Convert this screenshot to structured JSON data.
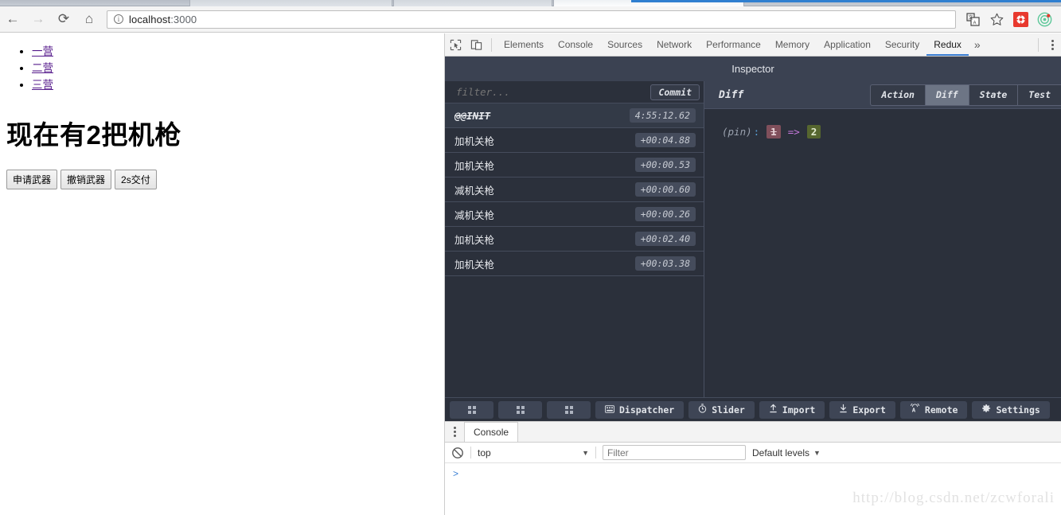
{
  "browser": {
    "back_icon": "back-arrow-icon",
    "forward_icon": "forward-arrow-icon",
    "reload_icon": "reload-icon",
    "home_icon": "home-icon",
    "info_glyph": "i",
    "url_host": "localhost",
    "url_port": ":3000",
    "url_full": "localhost:3000",
    "translate_icon": "translate-icon",
    "bookmark_icon": "star-icon",
    "extension_red_icon": "extension-icon",
    "extension_green_icon": "react-devtools-icon",
    "tab_accent": "#2f7fd0"
  },
  "page": {
    "links": [
      {
        "label": "一营"
      },
      {
        "label": "二营"
      },
      {
        "label": "三营"
      }
    ],
    "heading": "现在有2把机枪",
    "buttons": [
      {
        "label": "申请武器"
      },
      {
        "label": "撤销武器"
      },
      {
        "label": "2s交付"
      }
    ],
    "link_color": "#551a8b"
  },
  "devtools": {
    "inspect_element_icon": "inspect-element-icon",
    "device_toolbar_icon": "device-toolbar-icon",
    "tabs": [
      {
        "label": "Elements",
        "active": false
      },
      {
        "label": "Console",
        "active": false
      },
      {
        "label": "Sources",
        "active": false
      },
      {
        "label": "Network",
        "active": false
      },
      {
        "label": "Performance",
        "active": false
      },
      {
        "label": "Memory",
        "active": false
      },
      {
        "label": "Application",
        "active": false
      },
      {
        "label": "Security",
        "active": false
      },
      {
        "label": "Redux",
        "active": true
      }
    ],
    "more_tabs_glyph": "»",
    "menu_icon": "kebab-menu-icon",
    "active_tab_underline": "#3b7fd4"
  },
  "redux": {
    "title": "Inspector",
    "filter_placeholder": "filter...",
    "commit_label": "Commit",
    "actions": [
      {
        "name": "@@INIT",
        "time": "4:55:12.62",
        "selected": true
      },
      {
        "name": "加机关枪",
        "time": "+00:04.88",
        "selected": false
      },
      {
        "name": "加机关枪",
        "time": "+00:00.53",
        "selected": false
      },
      {
        "name": "减机关枪",
        "time": "+00:00.60",
        "selected": false
      },
      {
        "name": "减机关枪",
        "time": "+00:00.26",
        "selected": false
      },
      {
        "name": "加机关枪",
        "time": "+00:02.40",
        "selected": false
      },
      {
        "name": "加机关枪",
        "time": "+00:03.38",
        "selected": false
      }
    ],
    "inspector_label": "Diff",
    "inspector_tabs": [
      {
        "label": "Action",
        "active": false
      },
      {
        "label": "Diff",
        "active": true
      },
      {
        "label": "State",
        "active": false
      },
      {
        "label": "Test",
        "active": false
      }
    ],
    "diff": {
      "key": "(pin)",
      "colon": ":",
      "old_value": "1",
      "arrow": "=>",
      "new_value": "2"
    },
    "footer_buttons": [
      {
        "label": "",
        "icon": "grid-icon",
        "square": true
      },
      {
        "label": "",
        "icon": "grid-icon",
        "square": true
      },
      {
        "label": "",
        "icon": "grid-icon",
        "square": true
      },
      {
        "label": "Dispatcher",
        "icon": "keyboard-icon",
        "square": false
      },
      {
        "label": "Slider",
        "icon": "stopwatch-icon",
        "square": false
      },
      {
        "label": "Import",
        "icon": "upload-icon",
        "square": false
      },
      {
        "label": "Export",
        "icon": "download-icon",
        "square": false
      },
      {
        "label": "Remote",
        "icon": "broadcast-icon",
        "square": false
      },
      {
        "label": "Settings",
        "icon": "gear-icon",
        "square": false
      }
    ],
    "bg_color": "#2b303b",
    "panel_header_color": "#3b4252",
    "diff_old_color": "#804f5b",
    "diff_new_color": "#56662f"
  },
  "console_drawer": {
    "menu_icon": "kebab-menu-icon",
    "tab_label": "Console",
    "clear_icon": "clear-console-icon",
    "context_value": "top",
    "filter_placeholder": "Filter",
    "filter_value": "",
    "levels_label": "Default levels",
    "prompt_glyph": ">"
  },
  "watermark": {
    "text": "http://blog.csdn.net/zcwforali"
  }
}
